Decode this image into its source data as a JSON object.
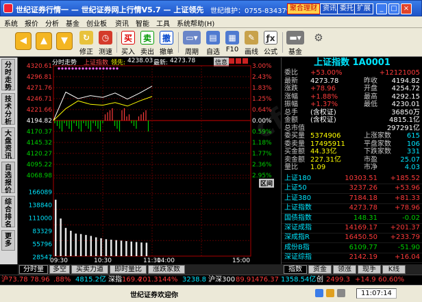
{
  "titlebar": {
    "title": "世纪证券行情一 — 世纪证券网上行情V5.7 — 上证领先",
    "hotline": "世纪维护：0755-83437957",
    "btn_wealth": "聚合理财",
    "btn_quote": "资讯",
    "btn_hk": "委托",
    "btn_ext": "扩展"
  },
  "menu": [
    "系统",
    "报价",
    "分析",
    "基金",
    "创业板",
    "资讯",
    "智能",
    "工具",
    "系统帮助(H)"
  ],
  "toolbar": {
    "revise": "修正",
    "speed": "测速",
    "buy": "买入",
    "sell": "卖出",
    "cancel": "撤单",
    "period": "周期",
    "watchlist": "自选",
    "f10": "F10",
    "draw": "画线",
    "formula": "公式",
    "fund": "基金"
  },
  "left_tabs": [
    "分时走势",
    "技术分析",
    "大盘资讯",
    "自选报价",
    "综合排名",
    "更多"
  ],
  "chart": {
    "header_label": "分时走势",
    "header_index": "上证指数",
    "lead_label": "领先:",
    "lead_value": "4238.03",
    "last_label": "最新:",
    "last_value": "4273.78",
    "info_btn": "信息",
    "price_labels": [
      "4320.61",
      "4296.81",
      "4271.76",
      "4246.71",
      "4221.66",
      "4194.82",
      "4170.37",
      "4145.32",
      "4120.27",
      "4095.22",
      "4068.98"
    ],
    "pct_labels": [
      "3.00%",
      "2.43%",
      "1.83%",
      "1.25%",
      "0.64%",
      "0.00%",
      "0.59%",
      "1.18%",
      "1.77%",
      "2.36%",
      "2.95%"
    ],
    "vol_labels": [
      "166089",
      "138840",
      "111000",
      "83329",
      "55796",
      "28547"
    ],
    "time_labels": [
      "09:30",
      "10:30",
      "11:30",
      "14:00",
      "15:00"
    ],
    "side_btn": "区间",
    "chart_data": {
      "type": "line",
      "x": [
        "09:30",
        "09:45",
        "10:00",
        "10:15",
        "10:30",
        "10:45",
        "11:00",
        "11:15",
        "11:30"
      ],
      "series": [
        {
          "values": [
            4194.82,
            4260,
            4245,
            4252,
            4248,
            4258,
            4244,
            4258,
            4273.78
          ]
        },
        {
          "values": [
            4194.82,
            4222,
            4240,
            4232,
            4230,
            4236,
            4228,
            4240,
            4250
          ]
        }
      ],
      "ylim": [
        4068.98,
        4320.61
      ],
      "volume": [
        120000,
        80000,
        60000,
        54000,
        48000,
        47000,
        45000,
        43000,
        40000,
        38000,
        36000,
        35000,
        34000,
        33000,
        32000,
        31000,
        30000,
        29000,
        28547
      ],
      "vol_ylim": [
        0,
        166089
      ]
    }
  },
  "right": {
    "title": "上证指数 1A0001",
    "rows": [
      {
        "l": "委比",
        "v": "+53.00%",
        "l2": "",
        "v2": "+12121005"
      },
      {
        "l": "最新",
        "v": "4273.78",
        "l2": "昨收",
        "v2": "4194.82"
      },
      {
        "l": "涨跌",
        "v": "+78.96",
        "l2": "开盘",
        "v2": "4254.72"
      },
      {
        "l": "涨幅",
        "v": "+1.88%",
        "l2": "最高",
        "v2": "4292.15"
      },
      {
        "l": "振幅",
        "v": "+1.37%",
        "l2": "最低",
        "v2": "4230.01"
      },
      {
        "l": "总手",
        "v": "(含权证)",
        "l2": "",
        "v2": "36850万"
      },
      {
        "l": "金额",
        "v": "(含权证)",
        "l2": "",
        "v2": "4815.1亿"
      },
      {
        "l": "总市值",
        "v": "",
        "l2": "",
        "v2": "297291亿"
      },
      {
        "l": "委买量",
        "v": "5374906",
        "l2": "上涨家数",
        "v2": "615"
      },
      {
        "l": "委卖量",
        "v": "17495911",
        "l2": "平盘家数",
        "v2": "106"
      },
      {
        "l": "买金额",
        "v": "44.33亿",
        "l2": "下跌家数",
        "v2": "331"
      },
      {
        "l": "卖金额",
        "v": "227.31亿",
        "l2": "市盈",
        "v2": "25.07"
      },
      {
        "l": "量比",
        "v": "1.09",
        "l2": "市净",
        "v2": "4.03"
      }
    ],
    "indices": [
      {
        "n": "上证180",
        "p": "10303.51",
        "c": "+185.52"
      },
      {
        "n": "上证50",
        "p": "3237.26",
        "c": "+53.96"
      },
      {
        "n": "上证380",
        "p": "7184.18",
        "c": "+81.33"
      },
      {
        "n": "上证指数",
        "p": "4273.78",
        "c": "+78.96"
      },
      {
        "n": "国债指数",
        "p": "148.31",
        "c": "-0.02"
      },
      {
        "n": "深证成指",
        "p": "14169.17",
        "c": "+201.37"
      },
      {
        "n": "深成指R",
        "p": "16450.50",
        "c": "+233.79"
      },
      {
        "n": "成份B指",
        "p": "6109.77",
        "c": "-51.90"
      },
      {
        "n": "深证综指",
        "p": "2142.19",
        "c": "+16.04"
      }
    ]
  },
  "bottom_tabs": [
    "分时量",
    "多空",
    "买卖力道",
    "即时量比",
    "涨跌家数"
  ],
  "right_tabs": [
    "指数",
    "资金",
    "领涨",
    "现手",
    "K线"
  ],
  "ticker": {
    "t1": "沪73.78",
    "t2": "78.96",
    "t3": ".88%",
    "t4": "4815.2亿",
    "t5": "深指",
    "t6": "169.4",
    "t7": "201.31",
    "t8": ".44%",
    "t9": "3238.8",
    "t10": "沪深300",
    "t11": "89.91",
    "t12": "476.37",
    "t13": "1358.54亿",
    "t14": "创",
    "t15": "2499.3",
    "t16": "+14.9",
    "t17": "60.60%"
  },
  "status": {
    "message": "世纪证券欢迎你",
    "time": "11:07:14"
  },
  "colors": {
    "up": "#ff3b3b",
    "down": "#00d000",
    "grid": "#8b0000",
    "cyan": "#00e6ff",
    "yellow": "#ffff00"
  }
}
